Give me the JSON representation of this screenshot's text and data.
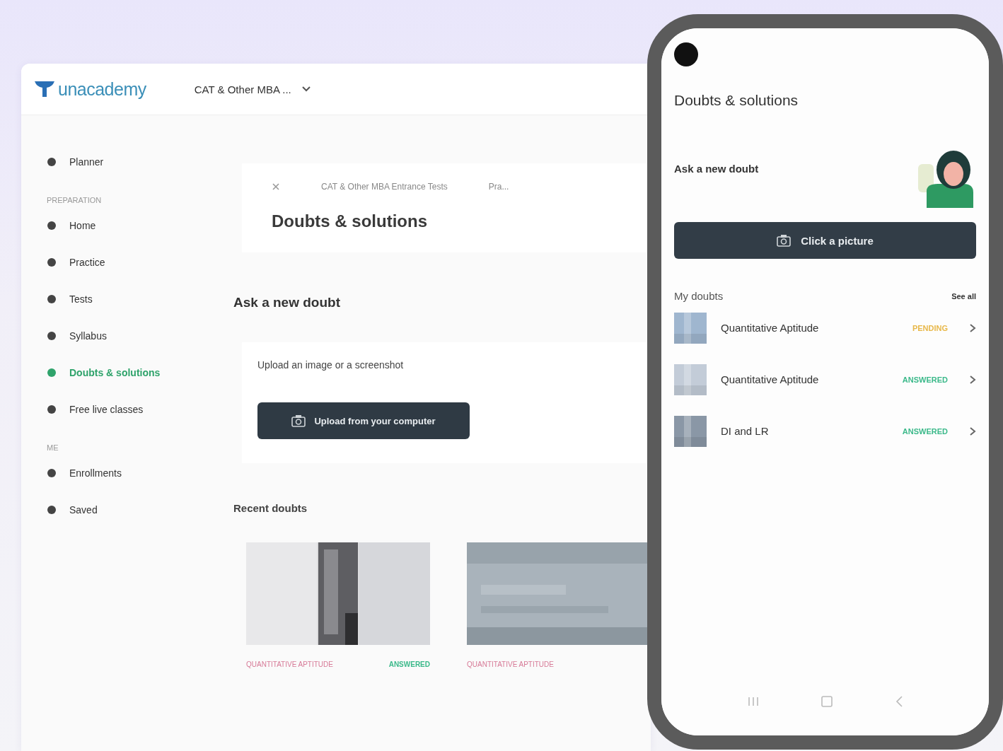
{
  "header": {
    "logo": "unacademy",
    "goal_selector": "CAT & Other MBA ..."
  },
  "sidebar": {
    "items": [
      {
        "kind": "item",
        "label": "Planner",
        "selected": false
      },
      {
        "kind": "heading",
        "label": "PREPARATION"
      },
      {
        "kind": "item",
        "label": "Home",
        "selected": false
      },
      {
        "kind": "item",
        "label": "Practice",
        "selected": false
      },
      {
        "kind": "item",
        "label": "Tests",
        "selected": false
      },
      {
        "kind": "item",
        "label": "Syllabus",
        "selected": false
      },
      {
        "kind": "item",
        "label": "Doubts & solutions",
        "selected": true
      },
      {
        "kind": "item",
        "label": "Free live classes",
        "selected": false
      },
      {
        "kind": "heading",
        "label": "ME"
      },
      {
        "kind": "item",
        "label": "Enrollments",
        "selected": false
      },
      {
        "kind": "item",
        "label": "Saved",
        "selected": false
      }
    ]
  },
  "main": {
    "breadcrumb": [
      "CAT & Other MBA Entrance Tests",
      "Pra..."
    ],
    "title": "Doubts & solutions",
    "ask": {
      "heading": "Ask a new doubt",
      "upload_title": "Upload an image or a screenshot",
      "button": "Upload from your computer"
    },
    "recent": {
      "heading": "Recent doubts",
      "cards": [
        {
          "subject": "QUANTITATIVE APTITUDE",
          "status": "ANSWERED",
          "kind": "answered"
        },
        {
          "subject": "QUANTITATIVE APTITUDE"
        }
      ]
    }
  },
  "phone": {
    "title": "Doubts & solutions",
    "ask_heading": "Ask a new doubt",
    "button": "Click a picture",
    "my_doubts": "My doubts",
    "see_all": "See all",
    "doubts": [
      {
        "title": "Quantitative Aptitude",
        "status": "PENDING",
        "kind": "pending"
      },
      {
        "title": "Quantitative Aptitude",
        "status": "ANSWERED",
        "kind": "answered"
      },
      {
        "title": "DI and LR",
        "status": "ANSWERED",
        "kind": "answered"
      }
    ]
  }
}
